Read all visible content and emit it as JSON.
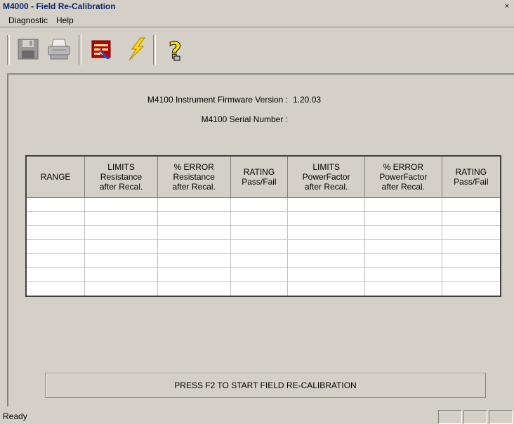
{
  "window": {
    "title": "M4000 - Field Re-Calibration",
    "close_glyph": "×"
  },
  "menu": {
    "items": [
      "Diagnostic",
      "Help"
    ]
  },
  "toolbar": {
    "icons": [
      "save-icon",
      "print-icon",
      "calibration-table-icon",
      "lightning-icon",
      "help-icon"
    ]
  },
  "info": {
    "firmware_label": "M4100 Instrument Firmware Version :",
    "firmware_value": "1.20.03",
    "serial_label": "M4100 Serial Number :",
    "serial_value": ""
  },
  "table": {
    "headers": [
      [
        "RANGE"
      ],
      [
        "LIMITS",
        "Resistance",
        "after Recal."
      ],
      [
        "% ERROR",
        "Resistance",
        "after Recal."
      ],
      [
        "RATING",
        "Pass/Fail"
      ],
      [
        "LIMITS",
        "PowerFactor",
        "after Recal."
      ],
      [
        "% ERROR",
        "PowerFactor",
        "after Recal."
      ],
      [
        "RATING",
        "Pass/Fail"
      ]
    ],
    "rows": [
      [
        "",
        "",
        "",
        "",
        "",
        "",
        ""
      ],
      [
        "",
        "",
        "",
        "",
        "",
        "",
        ""
      ],
      [
        "",
        "",
        "",
        "",
        "",
        "",
        ""
      ],
      [
        "",
        "",
        "",
        "",
        "",
        "",
        ""
      ],
      [
        "",
        "",
        "",
        "",
        "",
        "",
        ""
      ],
      [
        "",
        "",
        "",
        "",
        "",
        "",
        ""
      ],
      [
        "",
        "",
        "",
        "",
        "",
        "",
        ""
      ]
    ]
  },
  "start_button": {
    "label": "PRESS F2 TO START FIELD RE-CALIBRATION"
  },
  "status": {
    "text": "Ready"
  }
}
